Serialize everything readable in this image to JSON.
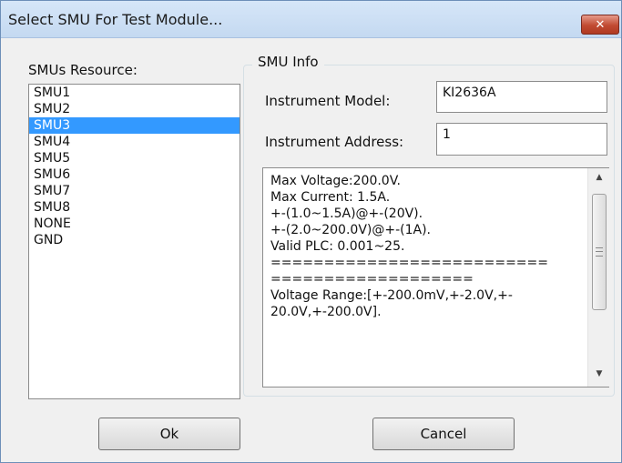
{
  "window": {
    "title": "Select SMU For Test Module..."
  },
  "icons": {
    "close": "close-icon",
    "scroll_up": "scroll-up-icon",
    "scroll_down": "scroll-down-icon"
  },
  "resources": {
    "label": "SMUs Resource:",
    "items": [
      "SMU1",
      "SMU2",
      "SMU3",
      "SMU4",
      "SMU5",
      "SMU6",
      "SMU7",
      "SMU8",
      "NONE",
      "GND"
    ],
    "selected": "SMU3"
  },
  "smu_info": {
    "group_title": "SMU Info",
    "model_label": "Instrument Model:",
    "model_value": "KI2636A",
    "address_label": "Instrument Address:",
    "address_value": "1",
    "info_lines": [
      "Max Voltage:200.0V.",
      "Max Current: 1.5A.",
      "+-(1.0~1.5A)@+-(20V).",
      "+-(2.0~200.0V)@+-(1A).",
      "Valid PLC: 0.001~25.",
      "==========================",
      "===================",
      "Voltage Range:[+-200.0mV,+-2.0V,+-",
      "20.0V,+-200.0V]."
    ]
  },
  "buttons": {
    "ok": "Ok",
    "cancel": "Cancel"
  }
}
